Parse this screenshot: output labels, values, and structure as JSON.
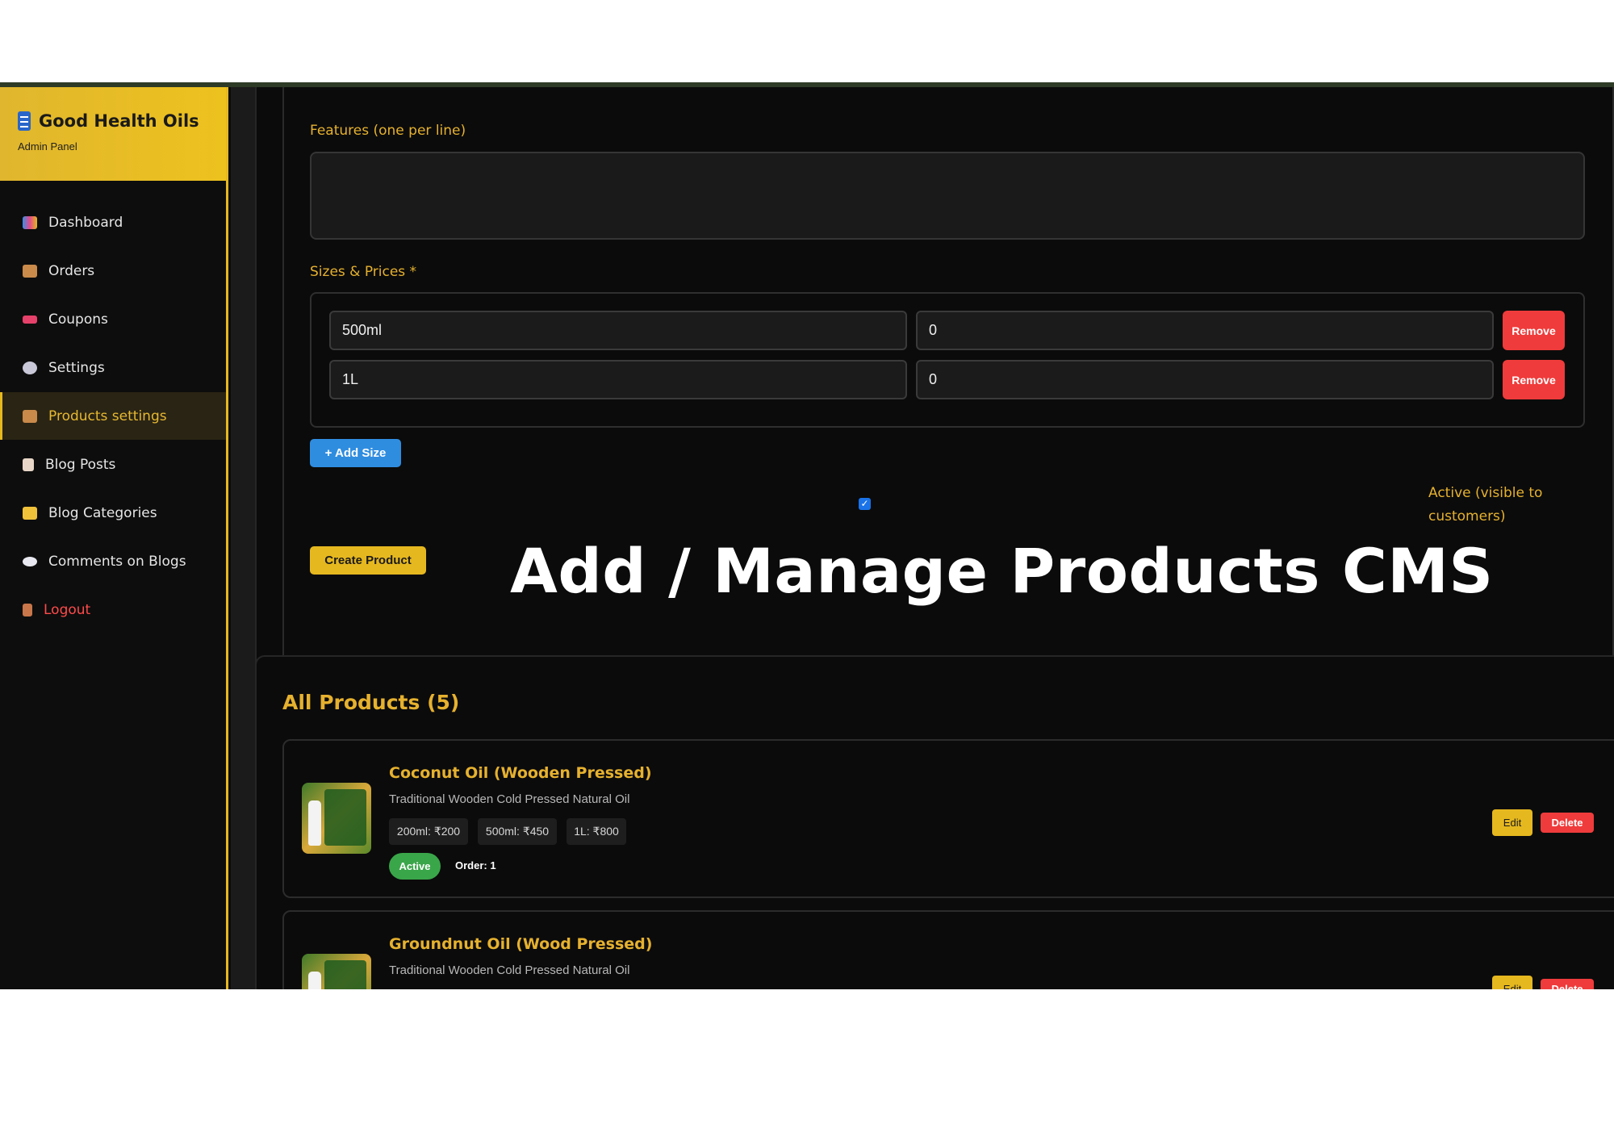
{
  "brand": {
    "title": "Good Health Oils",
    "subtitle": "Admin Panel"
  },
  "sidebar": {
    "items": [
      {
        "label": "Dashboard",
        "icon": "chart-icon"
      },
      {
        "label": "Orders",
        "icon": "box-icon"
      },
      {
        "label": "Coupons",
        "icon": "ticket-icon"
      },
      {
        "label": "Settings",
        "icon": "gear-icon"
      },
      {
        "label": "Products settings",
        "icon": "box-icon",
        "active": true
      },
      {
        "label": "Blog Posts",
        "icon": "memo-icon"
      },
      {
        "label": "Blog Categories",
        "icon": "folder-icon"
      },
      {
        "label": "Comments on Blogs",
        "icon": "speech-bubble-icon"
      },
      {
        "label": "Logout",
        "icon": "door-icon"
      }
    ]
  },
  "form": {
    "features_label": "Features (one per line)",
    "features_value": "",
    "sizes_label": "Sizes & Prices *",
    "sizes": [
      {
        "size": "500ml",
        "price": "0",
        "remove_label": "Remove"
      },
      {
        "size": "1L",
        "price": "0",
        "remove_label": "Remove"
      }
    ],
    "add_size_label": "+ Add Size",
    "active_checked": true,
    "active_label": "Active (visible to customers)",
    "create_label": "Create Product"
  },
  "overlay_title": "Add / Manage Products CMS",
  "products": {
    "heading": "All Products (5)",
    "items": [
      {
        "name": "Coconut Oil (Wooden Pressed)",
        "description": "Traditional Wooden Cold Pressed Natural Oil",
        "prices": [
          "200ml: ₹200",
          "500ml: ₹450",
          "1L: ₹800"
        ],
        "status": "Active",
        "order": "Order: 1",
        "edit_label": "Edit",
        "delete_label": "Delete"
      },
      {
        "name": "Groundnut Oil (Wood Pressed)",
        "description": "Traditional Wooden Cold Pressed Natural Oil",
        "edit_label": "Edit",
        "delete_label": "Delete"
      }
    ]
  },
  "colors": {
    "accent": "#e6b81f",
    "danger": "#ef3b3b",
    "primary": "#2f8de0",
    "success": "#3aa64a",
    "background": "#0b0b0b"
  }
}
